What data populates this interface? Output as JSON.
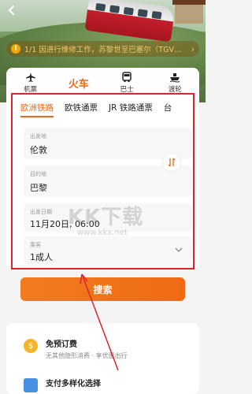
{
  "header": {
    "back_icon": "chevron-left-icon",
    "notice": "1/1 因进行维修工作，苏黎世至巴塞尔（TGV…"
  },
  "modes": [
    {
      "label": "机票",
      "icon": "plane-icon"
    },
    {
      "label": "火车",
      "icon": "train-icon"
    },
    {
      "label": "巴士",
      "icon": "bus-icon"
    },
    {
      "label": "渡轮",
      "icon": "ferry-icon"
    }
  ],
  "subtabs": [
    "欧洲铁路",
    "欧铁通票",
    "JR 铁路通票",
    "台"
  ],
  "form": {
    "from_label": "出发地",
    "from_value": "伦敦",
    "to_label": "目的地",
    "to_value": "巴黎",
    "date_label": "出发日期",
    "date_value": "11月20日, 06:00",
    "passenger_label": "乘客",
    "passenger_value": "1成人"
  },
  "search_label": "搜索",
  "watermark": {
    "main": "KK下载",
    "url": "www.kkx.net"
  },
  "features": [
    {
      "title": "免预订费",
      "desc": "无其他隐形消费 · 享优惠出行"
    },
    {
      "title": "支付多样化选择",
      "desc": ""
    }
  ],
  "colors": {
    "accent": "#e8691a",
    "highlight": "#d8262c"
  }
}
